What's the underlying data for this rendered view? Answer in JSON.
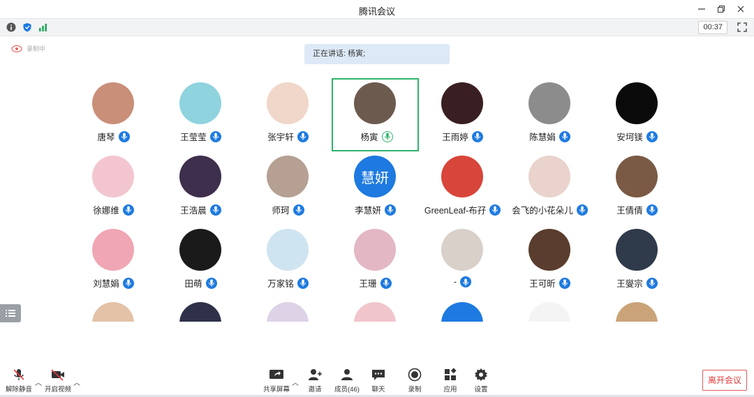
{
  "window": {
    "title": "腾讯会议",
    "controls": [
      "minimize-icon",
      "restore-icon",
      "close-icon"
    ]
  },
  "statusbar": {
    "icons": [
      "info-icon",
      "shield-icon",
      "signal-icon"
    ],
    "timer": "00:37"
  },
  "recording": {
    "label": "录制中"
  },
  "speaking": {
    "label": "正在讲话: 杨寅;"
  },
  "participants": [
    {
      "name": "唐琴",
      "mic": "on",
      "avatar_color": "#c98f78"
    },
    {
      "name": "王莹莹",
      "mic": "on",
      "avatar_color": "#8fd3df"
    },
    {
      "name": "张宇轩",
      "mic": "on",
      "avatar_color": "#f0d7c9"
    },
    {
      "name": "杨寅",
      "mic": "speaking",
      "avatar_color": "#6d5a4f",
      "active": true
    },
    {
      "name": "王雨婷",
      "mic": "on",
      "avatar_color": "#3a1f22"
    },
    {
      "name": "陈慧娟",
      "mic": "on",
      "avatar_color": "#8c8c8c"
    },
    {
      "name": "安坷镁",
      "mic": "on",
      "avatar_color": "#0b0b0b"
    },
    {
      "name": "徐娜维",
      "mic": "on",
      "avatar_color": "#f3c6cf"
    },
    {
      "name": "王浩晨",
      "mic": "on",
      "avatar_color": "#3e2f4d"
    },
    {
      "name": "师珂",
      "mic": "on",
      "avatar_color": "#b5a093"
    },
    {
      "name": "李慧妍",
      "mic": "on",
      "avatar_color": "#1e7ae0",
      "avatar_text": "慧妍"
    },
    {
      "name": "GreenLeaf-布孖",
      "mic": "on",
      "avatar_color": "#d8453a"
    },
    {
      "name": "会飞的小花朵儿",
      "mic": "on",
      "avatar_color": "#e9d3cc"
    },
    {
      "name": "王倩倩",
      "mic": "on",
      "avatar_color": "#7a5a44"
    },
    {
      "name": "刘慧娟",
      "mic": "on",
      "avatar_color": "#f0a6b4"
    },
    {
      "name": "田萌",
      "mic": "on",
      "avatar_color": "#1a1a1a"
    },
    {
      "name": "万家铭",
      "mic": "on",
      "avatar_color": "#cfe4f1"
    },
    {
      "name": "王珊",
      "mic": "on",
      "avatar_color": "#e3b7c4"
    },
    {
      "name": "-",
      "mic": "on",
      "avatar_color": "#d8d0c9"
    },
    {
      "name": "王可昕",
      "mic": "on",
      "avatar_color": "#5a3d2e"
    },
    {
      "name": "王燮宗",
      "mic": "on",
      "avatar_color": "#2f3a4a"
    },
    {
      "name": "",
      "mic": "none",
      "avatar_color": "#e3c2a8"
    },
    {
      "name": "",
      "mic": "none",
      "avatar_color": "#2e3148"
    },
    {
      "name": "",
      "mic": "none",
      "avatar_color": "#ddd2e6"
    },
    {
      "name": "",
      "mic": "none",
      "avatar_color": "#f1c5cc"
    },
    {
      "name": "",
      "mic": "none",
      "avatar_color": "#1e7ae0"
    },
    {
      "name": "",
      "mic": "none",
      "avatar_color": "#f4f4f4"
    },
    {
      "name": "",
      "mic": "none",
      "avatar_color": "#caa478"
    }
  ],
  "toolbar": {
    "unmute": "解除静音",
    "start_video": "开启视频",
    "share": "共享屏幕",
    "invite": "邀请",
    "members": "成员(46)",
    "chat": "聊天",
    "record": "录制",
    "apps": "应用",
    "settings": "设置",
    "leave": "离开会议"
  },
  "colors": {
    "accent": "#1e7ae0",
    "active_border": "#2fb36b",
    "leave_red": "#e03b3b",
    "speaking_bg": "#dde9f6"
  }
}
